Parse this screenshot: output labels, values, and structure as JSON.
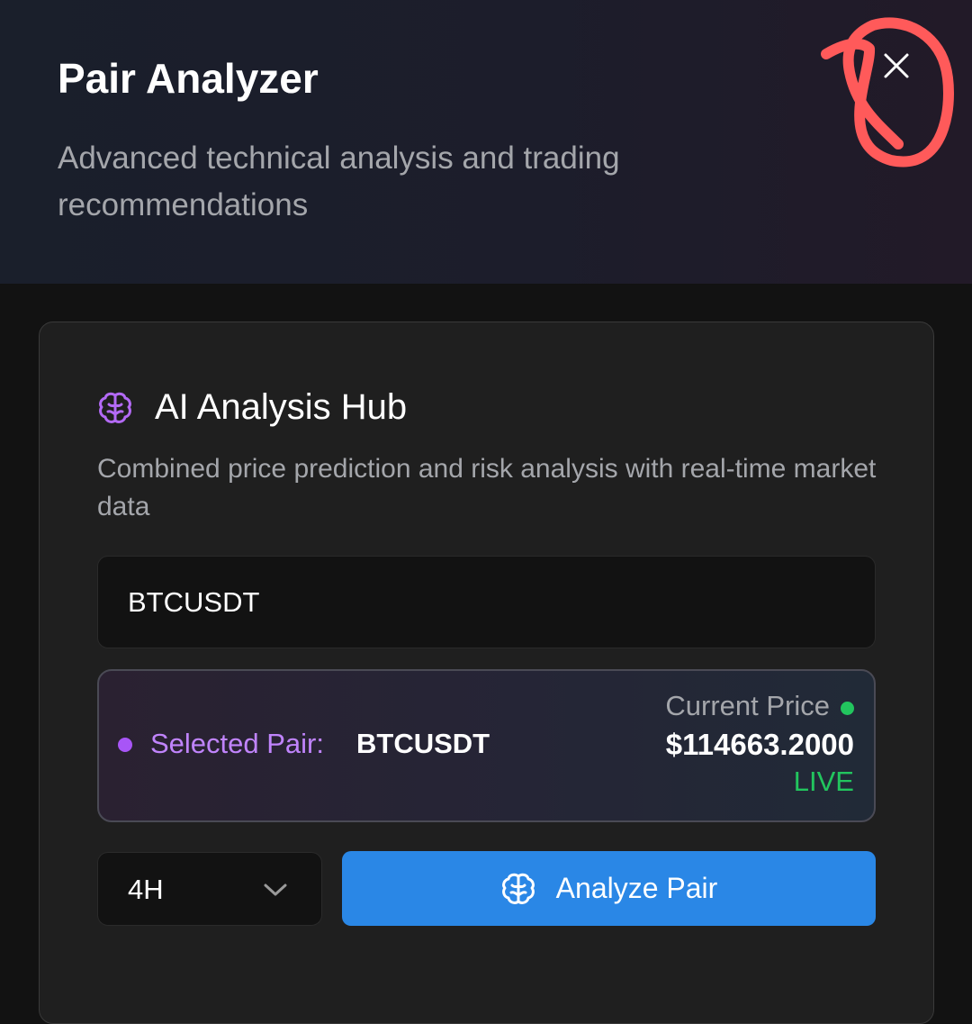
{
  "header": {
    "title": "Pair Analyzer",
    "subtitle": "Advanced technical analysis and trading recommendations",
    "close_icon": "close-icon"
  },
  "hub": {
    "icon": "brain-icon",
    "title": "AI Analysis Hub",
    "description": "Combined price prediction and risk analysis with real-time market data"
  },
  "pair_input": {
    "value": "BTCUSDT"
  },
  "selected": {
    "label": "Selected Pair:",
    "pair": "BTCUSDT",
    "price_label": "Current Price",
    "price": "$114663.2000",
    "status": "LIVE"
  },
  "timeframe": {
    "value": "4H",
    "icon": "chevron-down-icon"
  },
  "analyze_button": {
    "label": "Analyze Pair",
    "icon": "brain-icon"
  },
  "colors": {
    "accent_blue": "#2a87e6",
    "accent_purple": "#c084fc",
    "live_green": "#22c55e",
    "annotation_red": "#ff5a5a"
  }
}
